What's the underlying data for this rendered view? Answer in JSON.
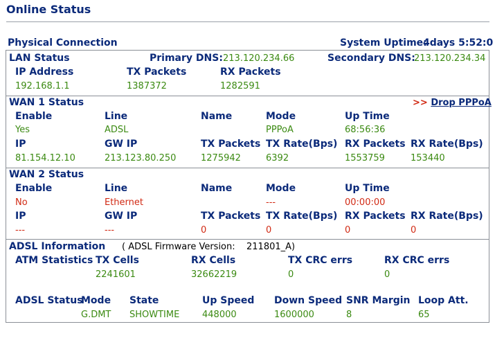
{
  "page": {
    "title": "Online Status"
  },
  "physical": {
    "label": "Physical Connection",
    "uptime_label": "System Uptime:",
    "uptime_value": "4days 5:52:0"
  },
  "lan": {
    "heading": "LAN Status",
    "primary_dns_label": "Primary DNS:",
    "primary_dns_value": "213.120.234.66",
    "secondary_dns_label": "Secondary DNS:",
    "secondary_dns_value": "213.120.234.34",
    "ip_label": "IP Address",
    "tx_label": "TX Packets",
    "rx_label": "RX Packets",
    "ip_value": "192.168.1.1",
    "tx_value": "1387372",
    "rx_value": "1282591"
  },
  "wan1": {
    "heading": "WAN 1 Status",
    "drop_arrows": ">>",
    "drop_label": "Drop PPPoA",
    "headers1": [
      "Enable",
      "Line",
      "Name",
      "Mode",
      "Up Time"
    ],
    "values1": [
      "Yes",
      "ADSL",
      "",
      "PPPoA",
      "68:56:36"
    ],
    "headers2": [
      "IP",
      "GW IP",
      "TX Packets",
      "TX Rate(Bps)",
      "RX Packets",
      "RX Rate(Bps)"
    ],
    "values2": [
      "81.154.12.10",
      "213.123.80.250",
      "1275942",
      "6392",
      "1553759",
      "153440"
    ]
  },
  "wan2": {
    "heading": "WAN 2 Status",
    "headers1": [
      "Enable",
      "Line",
      "Name",
      "Mode",
      "Up Time"
    ],
    "values1": [
      "No",
      "Ethernet",
      "",
      "---",
      "00:00:00"
    ],
    "headers2": [
      "IP",
      "GW IP",
      "TX Packets",
      "TX Rate(Bps)",
      "RX Packets",
      "RX Rate(Bps)"
    ],
    "values2": [
      "---",
      "---",
      "0",
      "0",
      "0",
      "0"
    ]
  },
  "adsl": {
    "heading": "ADSL Information",
    "fw_label": "( ADSL Firmware Version:",
    "fw_value": "211801_A)",
    "atm_label": "ATM Statistics",
    "atm_headers": [
      "TX Cells",
      "RX Cells",
      "TX CRC errs",
      "RX CRC errs"
    ],
    "atm_values": [
      "2241601",
      "32662219",
      "0",
      "0"
    ],
    "status_label": "ADSL Status",
    "status_headers": [
      "Mode",
      "State",
      "Up Speed",
      "Down Speed",
      "SNR Margin",
      "Loop Att."
    ],
    "status_values": [
      "G.DMT",
      "SHOWTIME",
      "448000",
      "1600000",
      "8",
      "65"
    ]
  }
}
